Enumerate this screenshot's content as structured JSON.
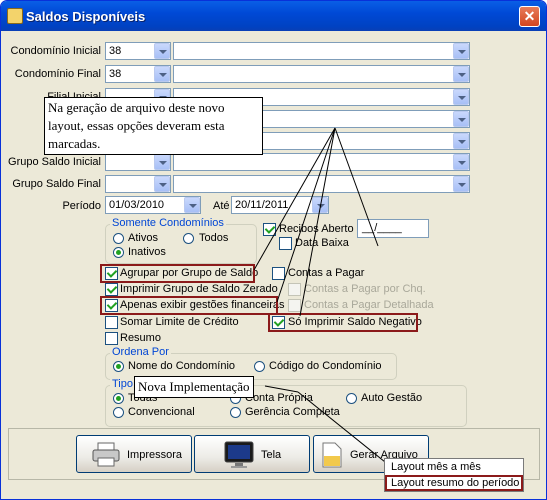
{
  "window": {
    "title": "Saldos Disponíveis",
    "close_glyph": "✕"
  },
  "fields": {
    "condominio_inicial": {
      "label": "Condomínio Inicial",
      "code": "38"
    },
    "condominio_final": {
      "label": "Condomínio Final",
      "code": "38"
    },
    "filial_inicial": {
      "label": "Filial Inicial"
    },
    "grupo_saldo_inicial": {
      "label": "Grupo Saldo Inicial"
    },
    "grupo_saldo_final": {
      "label": "Grupo Saldo Final"
    }
  },
  "periodo": {
    "label": "Período",
    "de": "01/03/2010",
    "ate_label": "Até",
    "ate": "20/11/2011"
  },
  "somente_condominios": {
    "legend": "Somente Condomínios",
    "options": [
      "Ativos",
      "Todos",
      "Inativos"
    ],
    "selected": "Inativos"
  },
  "recibos": {
    "recibos_aberto": "Recibos Aberto",
    "recibos_value": "__/____",
    "data_baixa": "Data Baixa"
  },
  "checks": {
    "agrupar": "Agrupar por Grupo de Saldo",
    "imprimir_zerado": "Imprimir Grupo de Saldo Zerado",
    "apenas_gestoes": "Apenas exibir gestões financeiras",
    "somar_limite": "Somar Limite de Crédito",
    "resumo": "Resumo",
    "contas_pagar": "Contas a Pagar",
    "contas_pagar_cheque": "Contas a Pagar por Chq.",
    "contas_pagar_detalhada": "Contas a Pagar Detalhada",
    "so_imprimir_negativo": "Só Imprimir Saldo Negativo"
  },
  "ordena_por": {
    "legend": "Ordena Por",
    "nome": "Nome do Condomínio",
    "codigo": "Código do Condomínio",
    "selected": "Nome do Condomínio"
  },
  "tipo": {
    "legend": "Tipo",
    "todas": "Todas",
    "conta_propria": "Conta Própria",
    "auto_gestao": "Auto Gestão",
    "convencional": "Convencional",
    "gerencia_completa": "Gerência Completa",
    "selected": "Todas"
  },
  "buttons": {
    "impressora": "Impressora",
    "tela": "Tela",
    "gerar_arquivo": "Gerar Arquivo"
  },
  "menu": {
    "items": [
      "Layout mês a mês",
      "Layout resumo do período"
    ],
    "selected": "Layout resumo do período"
  },
  "annotations": {
    "callout_main": "Na geração de arquivo deste novo layout, essas opções deveram esta marcadas.",
    "callout_new": "Nova Implementação"
  },
  "colors": {
    "accent": "#0046d5",
    "highlight": "#8b1a1a",
    "check": "#21a121"
  }
}
